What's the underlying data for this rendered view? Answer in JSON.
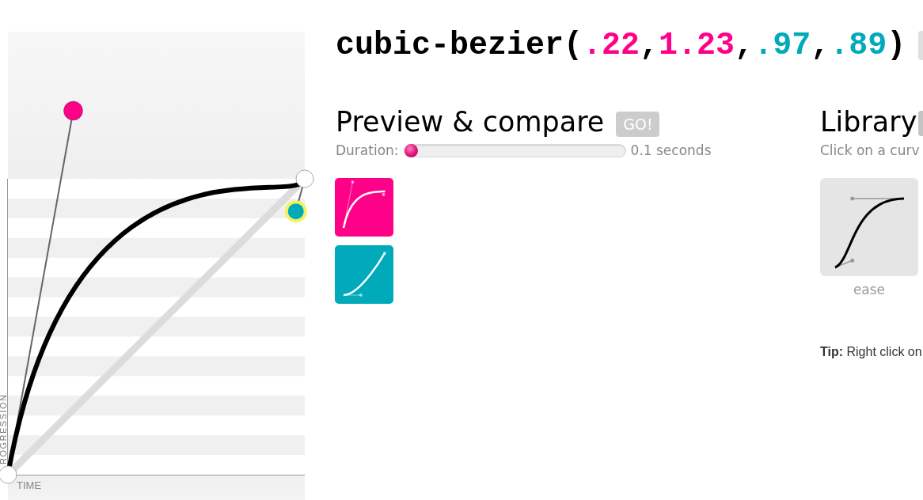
{
  "formula": [
    {
      "kind": "text",
      "text": "cubic-bezier("
    },
    {
      "kind": "p1",
      "text": ".22"
    },
    {
      "kind": "text",
      "text": ","
    },
    {
      "kind": "p1",
      "text": "1.23"
    },
    {
      "kind": "text",
      "text": ","
    },
    {
      "kind": "p2",
      "text": ".97"
    },
    {
      "kind": "text",
      "text": ","
    },
    {
      "kind": "p2",
      "text": ".89"
    },
    {
      "kind": "text",
      "text": ")"
    }
  ],
  "graph": {
    "y_axis_label": "ROGRESSION",
    "x_axis_label": "TIME",
    "handles": [
      {
        "selected": false
      },
      {
        "selected": true
      }
    ]
  },
  "preview": {
    "title": "Preview & compare",
    "go_button": "GO!",
    "duration": {
      "label": "Duration:",
      "level": 0,
      "reading": "0.1 seconds"
    },
    "tiles": [
      {
        "kind": "current"
      },
      {
        "kind": "compare"
      }
    ]
  },
  "library": {
    "title": "Library",
    "hint": "Click on a curv",
    "items": [
      {
        "label": "ease"
      }
    ],
    "tip": "**Tip:** Right click on"
  }
}
